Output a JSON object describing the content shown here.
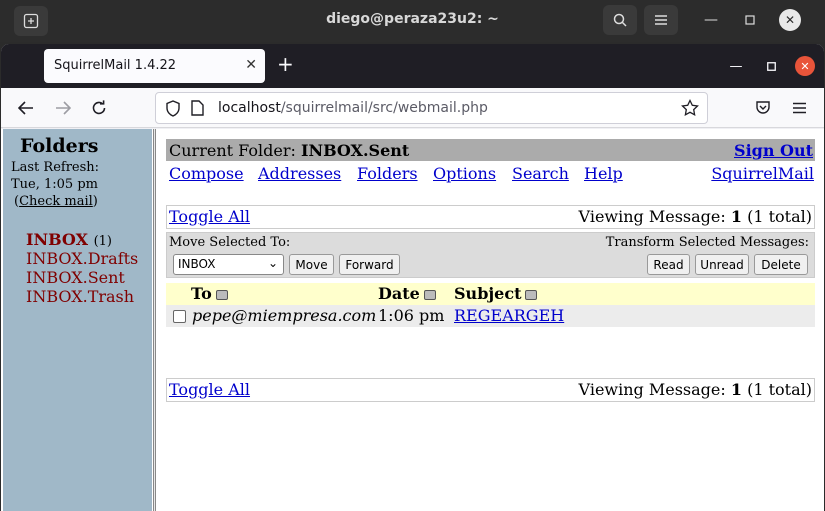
{
  "terminal": {
    "title": "diego@peraza23u2: ~"
  },
  "browser": {
    "tab_title": "SquirrelMail 1.4.22",
    "url_host": "localhost",
    "url_path": "/squirrelmail/src/webmail.php"
  },
  "left": {
    "title": "Folders",
    "last_refresh_label": "Last Refresh:",
    "last_refresh_time": "Tue, 1:05 pm",
    "check_mail_open": "(",
    "check_mail": "Check mail",
    "check_mail_close": ")",
    "folders": [
      {
        "name": "INBOX",
        "count": "(1)"
      },
      {
        "name": "INBOX.Drafts"
      },
      {
        "name": "INBOX.Sent"
      },
      {
        "name": "INBOX.Trash"
      }
    ]
  },
  "main": {
    "current_folder_label": "Current Folder:",
    "current_folder": "INBOX.Sent",
    "sign_out": "Sign Out",
    "menu": [
      "Compose",
      "Addresses",
      "Folders",
      "Options",
      "Search",
      "Help"
    ],
    "squirrelmail_link": "SquirrelMail",
    "toggle_all": "Toggle All",
    "viewing_prefix": "Viewing Message:",
    "viewing_num": "1",
    "viewing_suffix": "(1 total)",
    "move_selected_label": "Move Selected To:",
    "transform_label": "Transform Selected Messages:",
    "move_target": "INBOX",
    "buttons": {
      "move": "Move",
      "forward": "Forward",
      "read": "Read",
      "unread": "Unread",
      "delete": "Delete"
    },
    "columns": {
      "to": "To",
      "date": "Date",
      "subject": "Subject"
    },
    "messages": [
      {
        "to": "pepe@miempresa.com",
        "date": "1:06 pm",
        "subject": "REGEARGEH"
      }
    ]
  }
}
